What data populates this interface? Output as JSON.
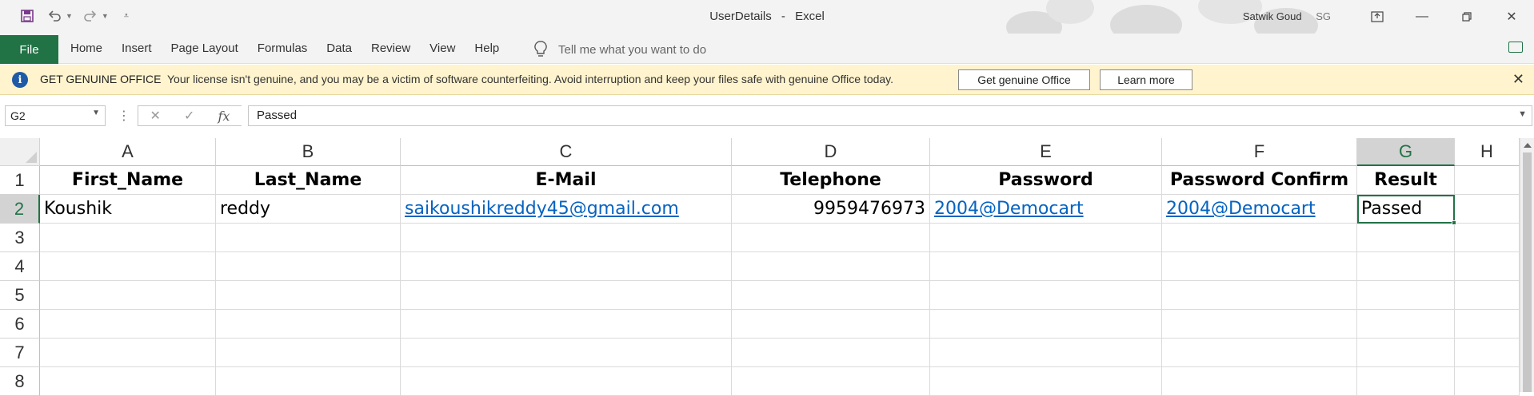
{
  "window": {
    "filename": "UserDetails",
    "separator": "-",
    "app": "Excel",
    "user_name": "Satwik Goud",
    "user_initials": "SG"
  },
  "quick_access": {
    "icons": [
      "save-icon",
      "undo-icon",
      "redo-icon",
      "customize-icon"
    ]
  },
  "ribbon": {
    "file_label": "File",
    "tabs": [
      "Home",
      "Insert",
      "Page Layout",
      "Formulas",
      "Data",
      "Review",
      "View",
      "Help"
    ],
    "tell_me_placeholder": "Tell me what you want to do"
  },
  "warning": {
    "title": "GET GENUINE OFFICE",
    "message": "Your license isn't genuine, and you may be a victim of software counterfeiting. Avoid interruption and keep your files safe with genuine Office today.",
    "button_primary": "Get genuine Office",
    "button_secondary": "Learn more"
  },
  "formula_bar": {
    "name_box": "G2",
    "value": "Passed",
    "fx_label": "fx"
  },
  "sheet": {
    "columns": [
      "A",
      "B",
      "C",
      "D",
      "E",
      "F",
      "G",
      "H"
    ],
    "rows": [
      "1",
      "2",
      "3",
      "4",
      "5",
      "6",
      "7",
      "8"
    ],
    "header_row": [
      "First_Name",
      "Last_Name",
      "E-Mail",
      "Telephone",
      "Password",
      "Password Confirm",
      "Result"
    ],
    "data_row": [
      "Koushik",
      "reddy",
      "saikoushikreddy45@gmail.com",
      "9959476973",
      "2004@Democart",
      "2004@Democart",
      "Passed"
    ],
    "active_cell": "G2"
  },
  "colors": {
    "accent": "#217346",
    "warning_bg": "#fff4ce",
    "link": "#0563c1"
  }
}
